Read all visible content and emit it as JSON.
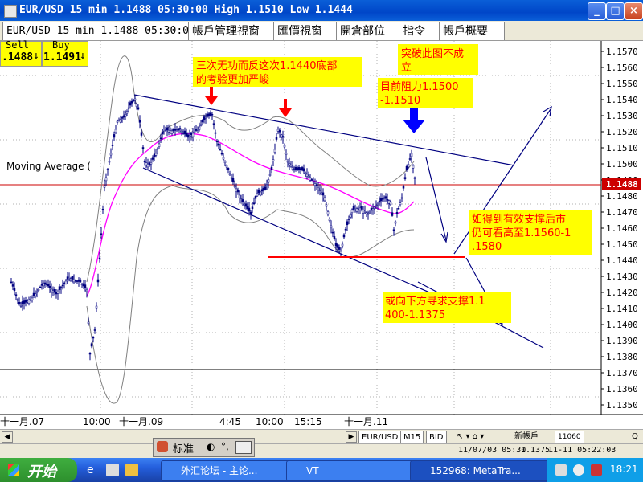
{
  "window": {
    "title": "EUR/USD 15 min 1.1488 05:30:00 High 1.1510 Low 1.1444",
    "buttons": [
      "_",
      "□",
      "×"
    ]
  },
  "tabs": [
    {
      "label": "EUR/USD 15 min 1.1488 05:30:00"
    },
    {
      "label": "帳戶管理視窗"
    },
    {
      "label": "匯價視窗"
    },
    {
      "label": "開倉部位"
    },
    {
      "label": "指令"
    },
    {
      "label": "帳戶概要"
    }
  ],
  "order": {
    "sell_label": "Sell",
    "sell_price": ".1488",
    "sell_arrow": "↓",
    "buy_label": "Buy",
    "buy_price": "1.1491",
    "buy_arrow": "↓"
  },
  "indicator_label": "Moving Average (",
  "annotations": {
    "a1_line1": "三次无功而反这次1.1440底部",
    "a1_line2": "的考验更加严峻",
    "a2_line1": "突破此图不成",
    "a2_line2": "立",
    "a3_line1": "目前阻力1.1500",
    "a3_line2": "-1.1510",
    "a4_line1": "如得到有效支撑后市",
    "a4_line2": "仍可看高至1.1560-1",
    "a4_line3": ".1580",
    "a5_line1": "或向下方寻求支撑1.1",
    "a5_line2": "400-1.1375"
  },
  "colors": {
    "candles": "#000080",
    "bollinger": "#808080",
    "ma": "#ff00ff",
    "trend": "#000080",
    "note_bg": "#ffff00",
    "note_text": "#ff0000",
    "support": "#ff0000",
    "price_line": "#cc0000"
  },
  "chart_data": {
    "type": "candlestick",
    "price_axis": [
      "1.1570",
      "1.1560",
      "1.1550",
      "1.1540",
      "1.1530",
      "1.1520",
      "1.1510",
      "1.1500",
      "1.1490",
      "1.1480",
      "1.1470",
      "1.1460",
      "1.1450",
      "1.1440",
      "1.1430",
      "1.1420",
      "1.1410",
      "1.1400",
      "1.1390",
      "1.1380",
      "1.1370",
      "1.1360",
      "1.1350"
    ],
    "ylim": [
      1.135,
      1.157
    ],
    "current_price": "1.1488",
    "time_axis": [
      "十一月.07",
      "10:00",
      "十一月.09",
      "4:45",
      "10:00",
      "15:15",
      "十一月.11"
    ],
    "grid": "dotted"
  },
  "bottom_bar": {
    "symbol_btn": "EUR/USD",
    "period_btn": "M15",
    "bid_btn": "BID",
    "date_left": "11/07/03 05:30",
    "value_mid": "1.1375",
    "date_right": "11-11 05:22:03",
    "small_value": "11060",
    "new_account": "新帳戶",
    "help": "Q"
  },
  "toolbar2": {
    "label": "标准"
  },
  "taskbar": {
    "start": "开始",
    "items": [
      "外汇论坛 - 主论...",
      "VT",
      "152968: MetaTra..."
    ],
    "clock": "18:21"
  }
}
